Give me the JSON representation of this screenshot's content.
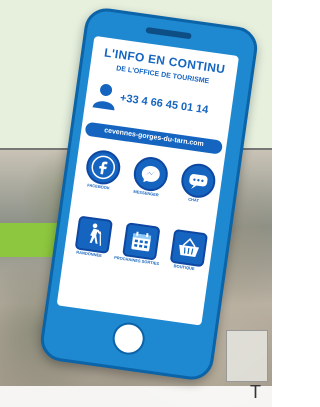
{
  "phone": {
    "title_line1": "L'INFO EN CONTINU",
    "title_line2": "DE L'OFFICE DE TOURISME",
    "phone_number": "+33 4 66 45 01 14",
    "website": "cevennes-gorges-du-tarn.com",
    "tiles": [
      {
        "icon": "facebook-icon",
        "label": "FACEBOOK"
      },
      {
        "icon": "messenger-icon",
        "label": "MESSENGER"
      },
      {
        "icon": "chat-icon",
        "label": "CHAT"
      },
      {
        "icon": "hiker-icon",
        "label": "RANDONNEE"
      },
      {
        "icon": "calendar-icon",
        "label": "PROCHAINES SORTIES"
      },
      {
        "icon": "basket-icon",
        "label": "BOUTIQUE"
      }
    ]
  },
  "background": {
    "accent_color": "#8dc63f",
    "phone_color": "#1e88d0"
  }
}
